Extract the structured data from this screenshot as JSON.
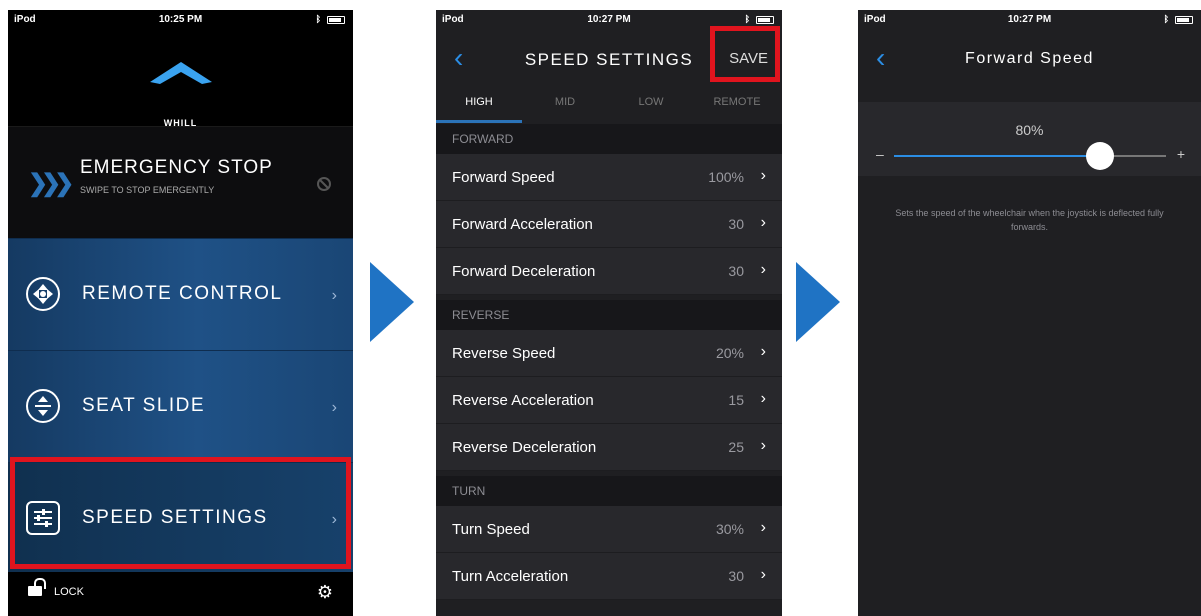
{
  "screen1": {
    "status": {
      "carrier": "iPod",
      "time": "10:25 PM"
    },
    "brand": "WHILL",
    "emergency": {
      "title": "EMERGENCY STOP",
      "subtitle": "SWIPE TO STOP EMERGENTLY"
    },
    "menu": [
      {
        "label": "REMOTE CONTROL",
        "icon": "remote-control-icon"
      },
      {
        "label": "SEAT SLIDE",
        "icon": "seat-slide-icon"
      },
      {
        "label": "SPEED SETTINGS",
        "icon": "speed-settings-icon"
      }
    ],
    "bottom": {
      "lock_label": "LOCK"
    }
  },
  "screen2": {
    "status": {
      "carrier": "iPod",
      "time": "10:27 PM"
    },
    "title": "SPEED SETTINGS",
    "save_label": "SAVE",
    "tabs": [
      "HIGH",
      "MID",
      "LOW",
      "REMOTE"
    ],
    "active_tab": "HIGH",
    "sections": [
      {
        "header": "FORWARD",
        "rows": [
          {
            "label": "Forward Speed",
            "value": "100%"
          },
          {
            "label": "Forward Acceleration",
            "value": "30"
          },
          {
            "label": "Forward Deceleration",
            "value": "30"
          }
        ]
      },
      {
        "header": "REVERSE",
        "rows": [
          {
            "label": "Reverse Speed",
            "value": "20%"
          },
          {
            "label": "Reverse Acceleration",
            "value": "15"
          },
          {
            "label": "Reverse Deceleration",
            "value": "25"
          }
        ]
      },
      {
        "header": "TURN",
        "rows": [
          {
            "label": "Turn Speed",
            "value": "30%"
          },
          {
            "label": "Turn Acceleration",
            "value": "30"
          }
        ]
      }
    ]
  },
  "screen3": {
    "status": {
      "carrier": "iPod",
      "time": "10:27 PM"
    },
    "title": "Forward Speed",
    "slider": {
      "value_label": "80%",
      "value": 0.8,
      "minus": "–",
      "plus": "+"
    },
    "description": "Sets the speed of the wheelchair when the joystick is deflected fully forwards."
  },
  "colors": {
    "accent": "#2b73b8",
    "highlight": "#e0141e",
    "link": "#2b8de4"
  }
}
